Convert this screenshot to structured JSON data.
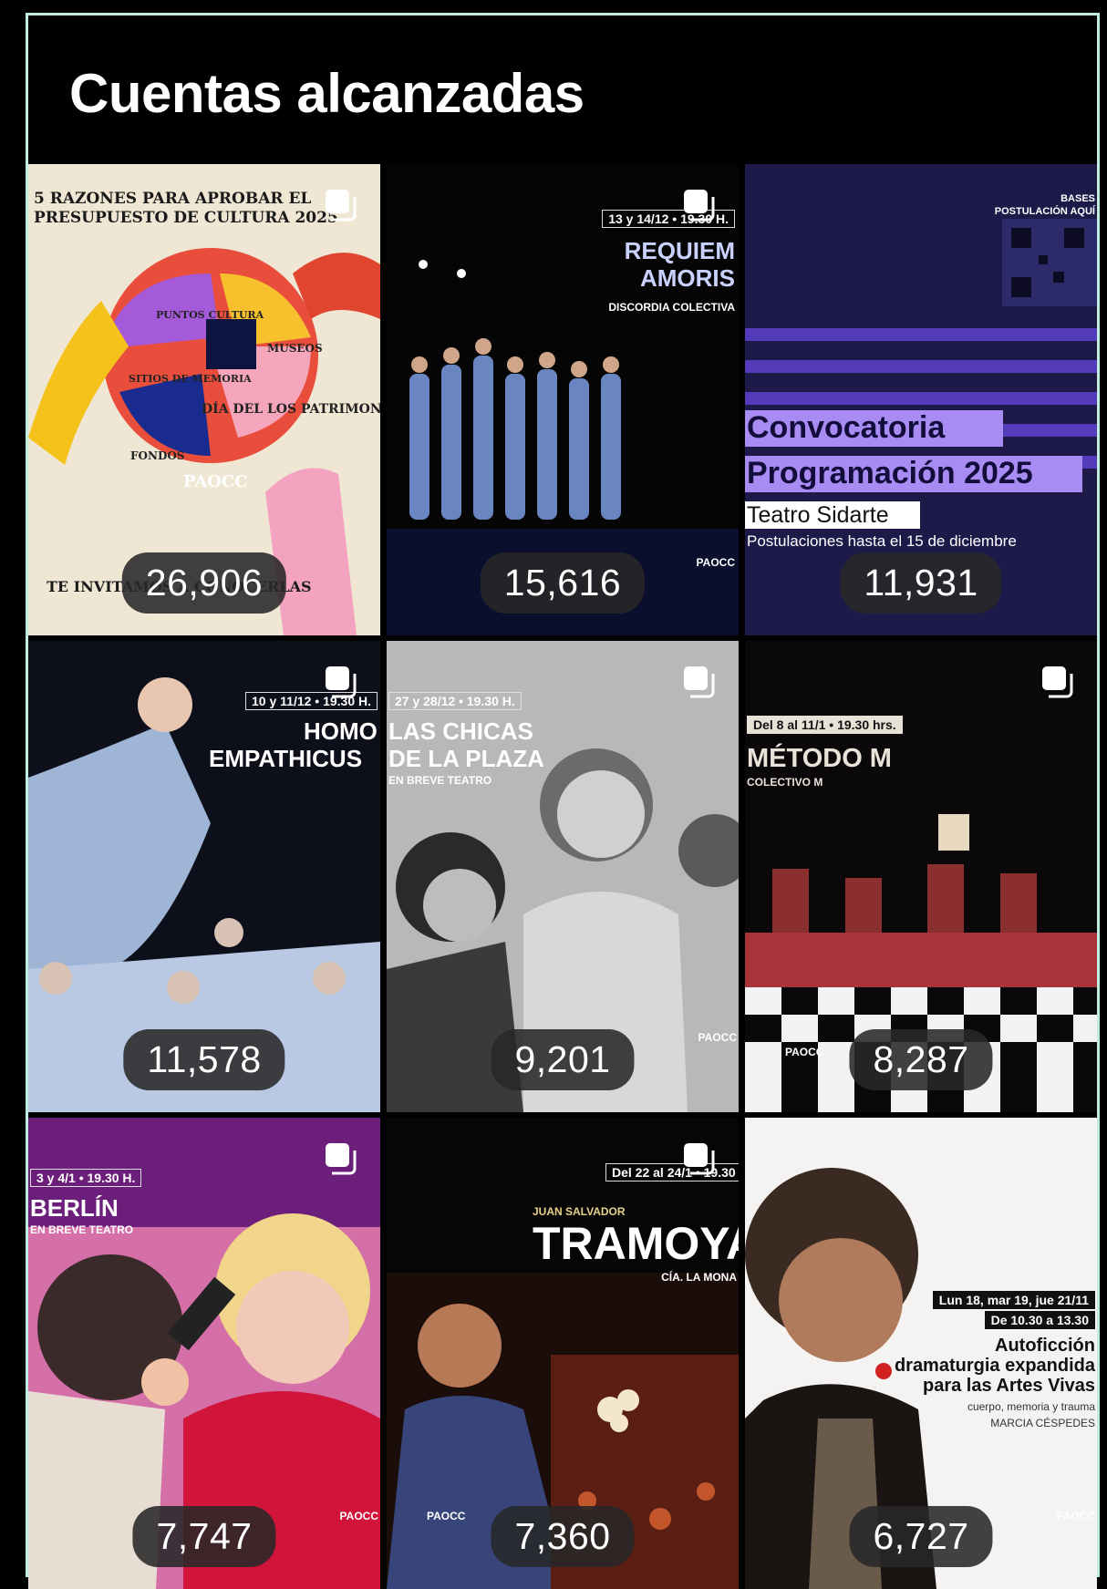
{
  "header": {
    "title": "Cuentas alcanzadas"
  },
  "posts": [
    {
      "count": "26,906",
      "line1": "5 RAZONES PARA APROBAR EL",
      "line2": "PRESUPUESTO DE CULTURA 2025",
      "labels": [
        "PUNTOS CULTURA",
        "MUSEOS",
        "SITIOS DE MEMORIA",
        "DÍA DEL LOS PATRIMONIOS",
        "FONDOS",
        "PAOCC"
      ],
      "footer": "TE INVITAMOS A CONOCERLAS"
    },
    {
      "count": "15,616",
      "date": "13 y 14/12 • 19.30 H.",
      "title1": "REQUIEM",
      "title2": "AMORIS",
      "sub": "DISCORDIA COLECTIVA",
      "logo": "PAOCC"
    },
    {
      "count": "11,931",
      "bases": "BASES",
      "postulacion": "POSTULACIÓN AQUÍ",
      "title1": "Convocatoria",
      "title2": "Programación 2025",
      "venue": "Teatro Sidarte",
      "deadline": "Postulaciones hasta el 15 de diciembre"
    },
    {
      "count": "11,578",
      "date": "10 y 11/12 • 19.30 H.",
      "title1": "HOMO",
      "title2": "EMPATHICUS"
    },
    {
      "count": "9,201",
      "date": "27 y 28/12 • 19.30 H.",
      "title1": "LAS CHICAS",
      "title2": "DE LA PLAZA",
      "sub": "EN BREVE TEATRO",
      "logo": "PAOCC"
    },
    {
      "count": "8,287",
      "date": "Del 8 al 11/1 • 19.30 hrs.",
      "title1": "MÉTODO M",
      "sub": "COLECTIVO M",
      "logo": "PAOCC"
    },
    {
      "count": "7,747",
      "date": "3 y 4/1 • 19.30 H.",
      "title1": "BERLÍN",
      "sub": "EN BREVE TEATRO",
      "logo": "PAOCC"
    },
    {
      "count": "7,360",
      "date": "Del 22 al 24/1 • 19.30",
      "kicker": "JUAN SALVADOR",
      "title1": "TRAMOYA",
      "sub": "CÍA. LA MONA",
      "logo": "PAOCC"
    },
    {
      "count": "6,727",
      "date1": "Lun 18, mar 19, jue 21/11",
      "date2": "De 10.30 a 13.30",
      "title1": "Autoficción",
      "title2": "dramaturgia expandida",
      "title3": "para las Artes Vivas",
      "sub1": "cuerpo, memoria y trauma",
      "sub2": "MARCIA CÉSPEDES",
      "logo": "PAOCC"
    }
  ],
  "icons": {
    "multi": "carousel-icon"
  },
  "colors": {
    "background": "#000000",
    "border": "#bfeee0",
    "pill": "#282828"
  }
}
